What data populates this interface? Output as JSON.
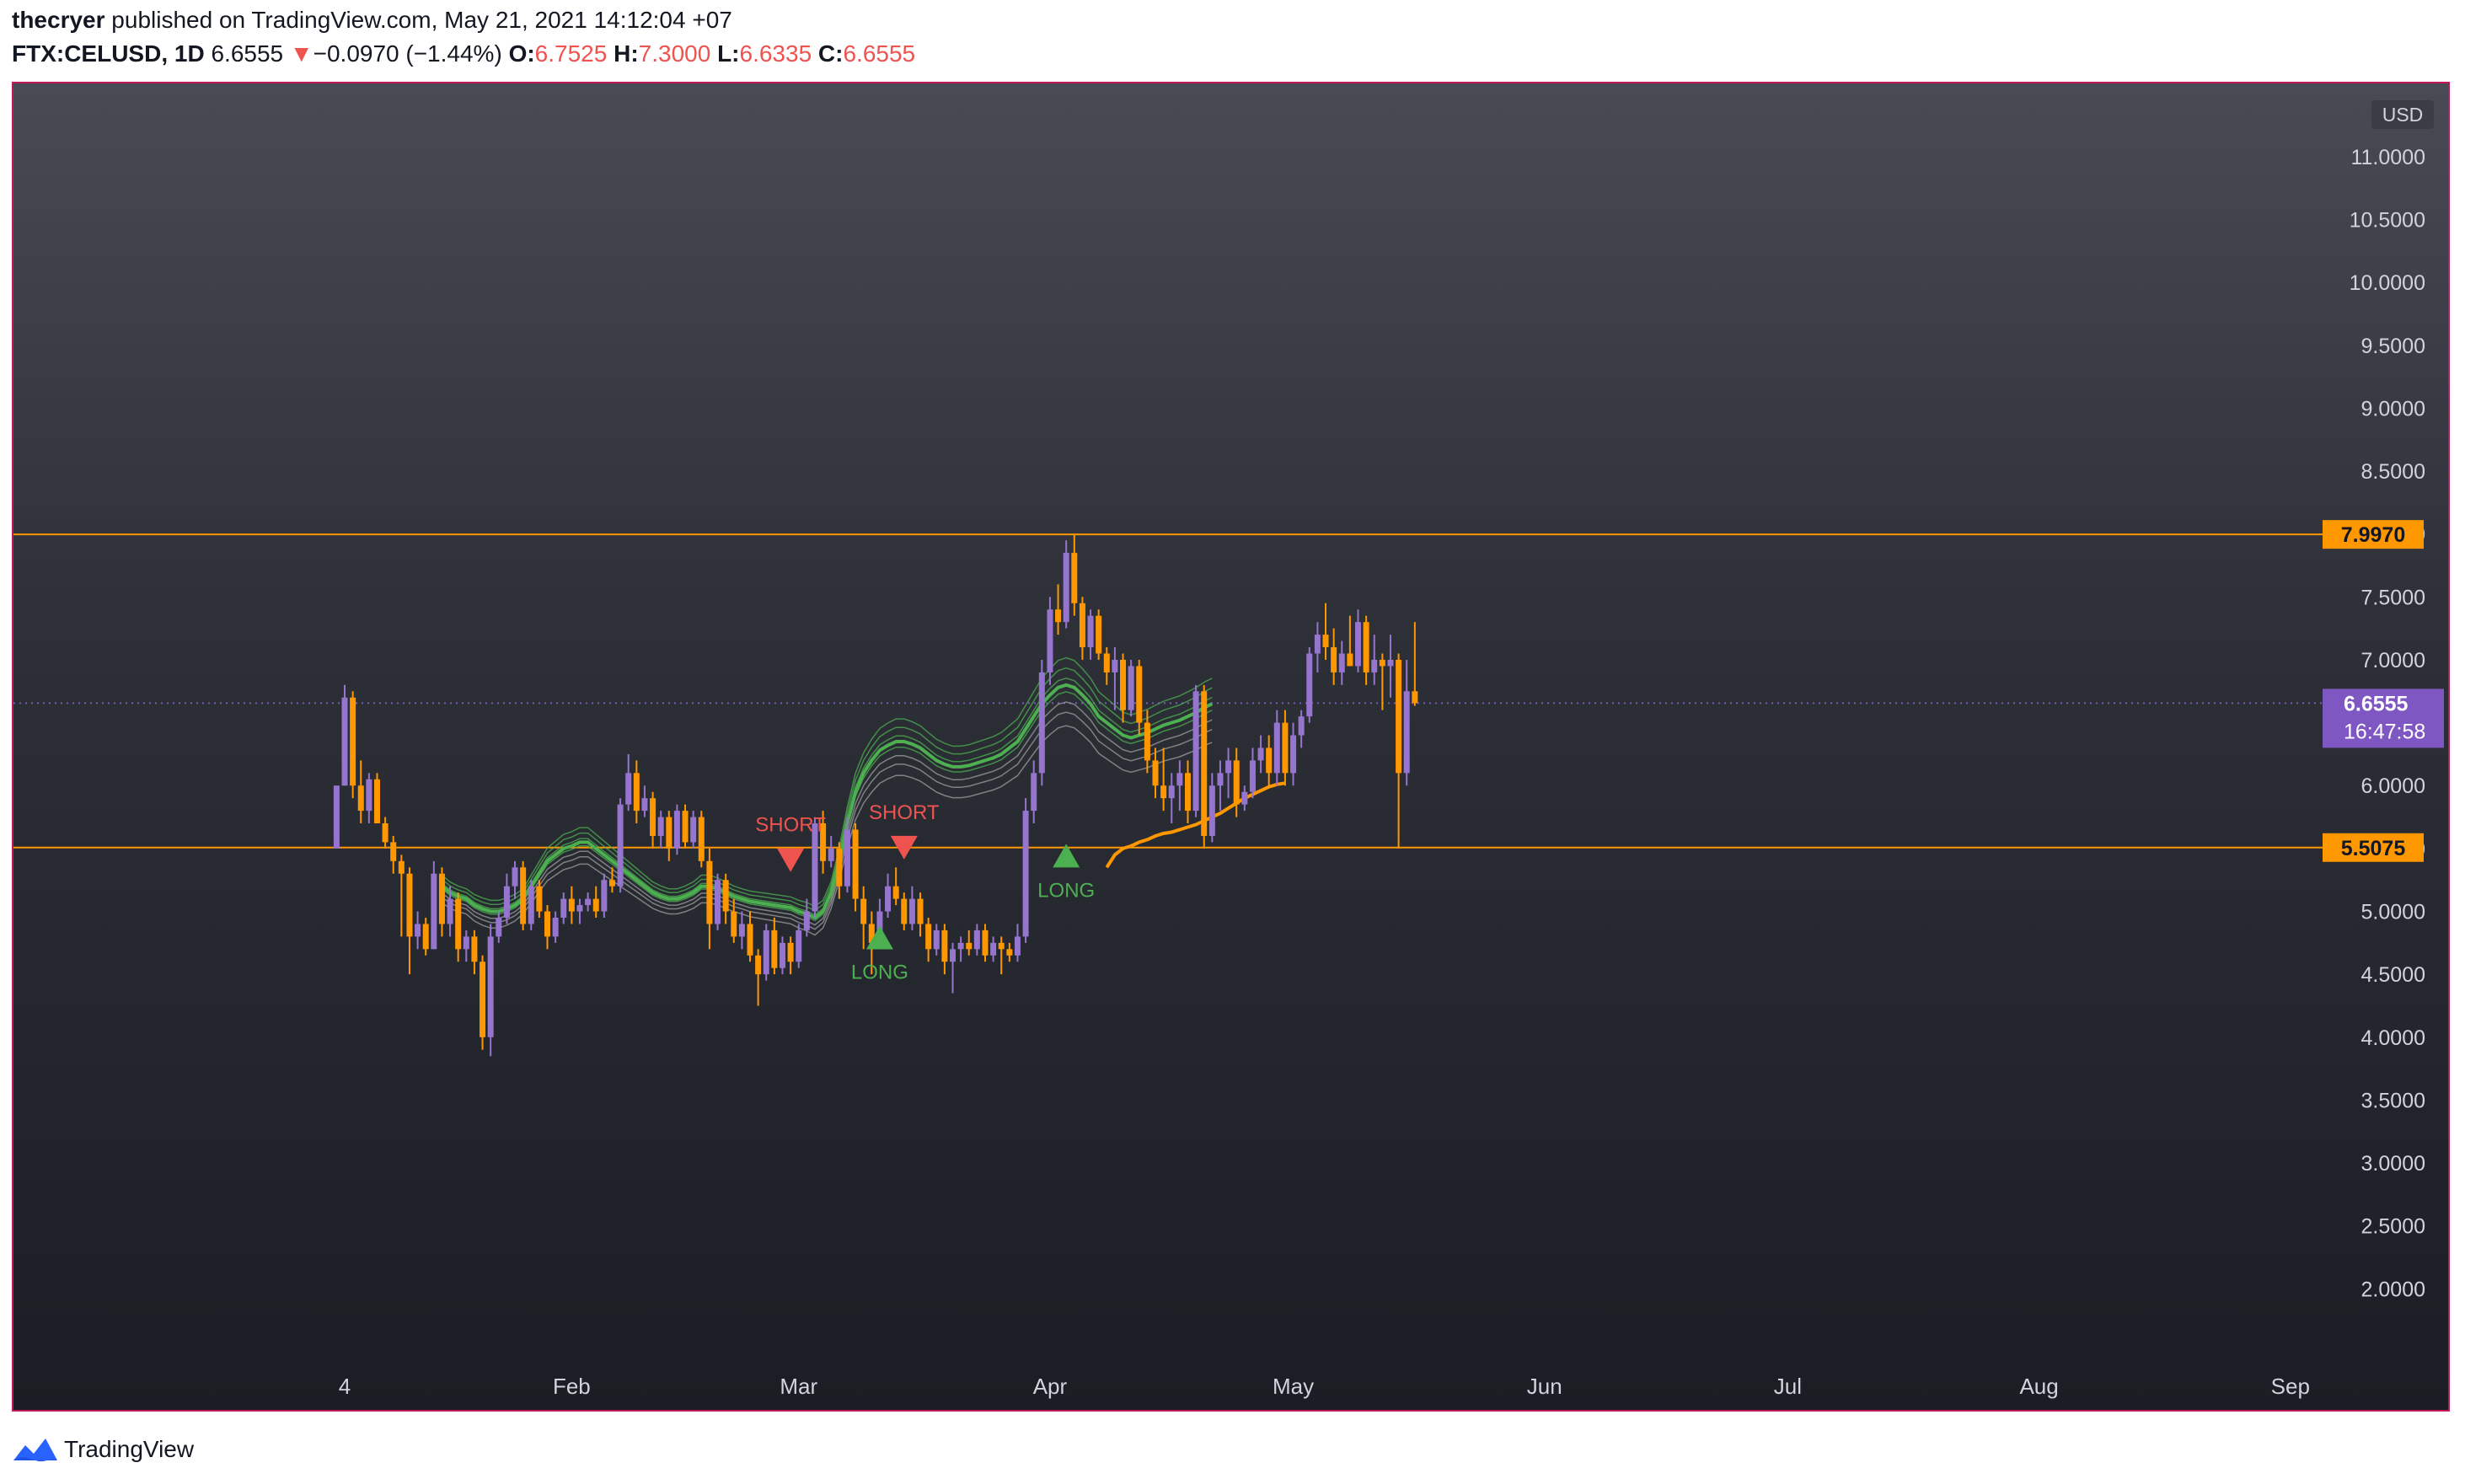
{
  "header": {
    "author": "thecryer",
    "published_text": "published on TradingView.com, May 21, 2021 14:12:04 +07",
    "symbol": "FTX:CELUSD, 1D",
    "last": "6.6555",
    "change_arrow": "▼",
    "change": "−0.0970 (−1.44%)",
    "o_label": "O:",
    "o_value": "6.7525",
    "h_label": "H:",
    "h_value": "7.3000",
    "l_label": "L:",
    "l_value": "6.6335",
    "c_label": "C:",
    "c_value": "6.6555"
  },
  "footer": {
    "brand": "TradingView",
    "logo_icon": "tradingview-logo-icon"
  },
  "colors": {
    "bull": "#9575cd",
    "bear": "#ff9800",
    "level": "#ff9800",
    "price_tag": "#7e57c2",
    "short": "#ef5350",
    "long": "#4caf50",
    "ema": "#ff9800",
    "ribbon_green": "#4caf50",
    "ribbon_grey": "#9e9e9e",
    "ribbon_red": "#ef5350",
    "frame": "#c2185b"
  },
  "chart_data": {
    "type": "candlestick",
    "currency": "USD",
    "y_ticks": [
      "11.0000",
      "10.5000",
      "10.0000",
      "9.5000",
      "9.0000",
      "8.5000",
      "8.0000",
      "7.5000",
      "7.0000",
      "6.5000",
      "6.0000",
      "5.5000",
      "5.0000",
      "4.5000",
      "4.0000",
      "3.5000",
      "3.0000",
      "2.5000",
      "2.0000"
    ],
    "ylim": [
      1.5,
      11.2
    ],
    "x_ticks": [
      {
        "label": "4",
        "date": "2021-01-04"
      },
      {
        "label": "Feb",
        "date": "2021-02-01"
      },
      {
        "label": "Mar",
        "date": "2021-03-01"
      },
      {
        "label": "Apr",
        "date": "2021-04-01"
      },
      {
        "label": "May",
        "date": "2021-05-01"
      },
      {
        "label": "Jun",
        "date": "2021-06-01"
      },
      {
        "label": "Jul",
        "date": "2021-07-01"
      },
      {
        "label": "Aug",
        "date": "2021-08-01"
      },
      {
        "label": "Sep",
        "date": "2021-09-01"
      }
    ],
    "horizontal_levels": [
      {
        "value": 7.997,
        "label": "7.9970"
      },
      {
        "value": 5.5075,
        "label": "5.5075"
      }
    ],
    "current_price": {
      "value": 6.6555,
      "label": "6.6555",
      "countdown": "16:47:58"
    },
    "signals": [
      {
        "type": "SHORT",
        "date": "2021-02-28",
        "price": 5.3
      },
      {
        "type": "SHORT",
        "date": "2021-03-14",
        "price": 5.4
      },
      {
        "type": "LONG",
        "date": "2021-03-11",
        "price": 4.9
      },
      {
        "type": "LONG",
        "date": "2021-04-03",
        "price": 5.55
      }
    ],
    "series": [
      {
        "name": "candles",
        "start": "2021-01-03",
        "ohlc": [
          [
            5.5,
            6.0,
            5.5,
            6.0
          ],
          [
            6.0,
            6.8,
            6.0,
            6.7
          ],
          [
            6.7,
            6.75,
            5.9,
            6.0
          ],
          [
            6.0,
            6.2,
            5.7,
            5.8
          ],
          [
            5.8,
            6.1,
            5.7,
            6.05
          ],
          [
            6.05,
            6.1,
            5.7,
            5.7
          ],
          [
            5.7,
            5.75,
            5.5,
            5.55
          ],
          [
            5.55,
            5.6,
            5.3,
            5.4
          ],
          [
            5.4,
            5.45,
            4.8,
            5.3
          ],
          [
            5.3,
            5.35,
            4.5,
            4.8
          ],
          [
            4.8,
            5.0,
            4.7,
            4.9
          ],
          [
            4.9,
            4.95,
            4.65,
            4.7
          ],
          [
            4.7,
            5.4,
            4.7,
            5.3
          ],
          [
            5.3,
            5.35,
            4.8,
            4.9
          ],
          [
            4.9,
            5.2,
            4.8,
            5.1
          ],
          [
            5.1,
            5.15,
            4.6,
            4.7
          ],
          [
            4.7,
            4.85,
            4.6,
            4.8
          ],
          [
            4.8,
            4.85,
            4.5,
            4.6
          ],
          [
            4.6,
            4.65,
            3.9,
            4.0
          ],
          [
            4.0,
            4.9,
            3.85,
            4.8
          ],
          [
            4.8,
            5.0,
            4.75,
            4.95
          ],
          [
            4.95,
            5.3,
            4.9,
            5.2
          ],
          [
            5.2,
            5.4,
            5.1,
            5.35
          ],
          [
            5.35,
            5.4,
            4.85,
            4.9
          ],
          [
            4.9,
            5.25,
            4.85,
            5.2
          ],
          [
            5.2,
            5.25,
            4.95,
            5.0
          ],
          [
            5.0,
            5.05,
            4.7,
            4.8
          ],
          [
            4.8,
            5.0,
            4.75,
            4.95
          ],
          [
            4.95,
            5.15,
            4.9,
            5.1
          ],
          [
            5.1,
            5.2,
            4.9,
            5.0
          ],
          [
            5.0,
            5.1,
            4.9,
            5.05
          ],
          [
            5.05,
            5.15,
            5.0,
            5.1
          ],
          [
            5.1,
            5.2,
            4.95,
            5.0
          ],
          [
            5.0,
            5.3,
            4.95,
            5.25
          ],
          [
            5.25,
            5.35,
            5.15,
            5.2
          ],
          [
            5.2,
            5.9,
            5.15,
            5.85
          ],
          [
            5.85,
            6.25,
            5.8,
            6.1
          ],
          [
            6.1,
            6.2,
            5.7,
            5.8
          ],
          [
            5.8,
            6.0,
            5.75,
            5.9
          ],
          [
            5.9,
            5.95,
            5.5,
            5.6
          ],
          [
            5.6,
            5.8,
            5.5,
            5.75
          ],
          [
            5.75,
            5.8,
            5.4,
            5.5
          ],
          [
            5.5,
            5.85,
            5.45,
            5.8
          ],
          [
            5.8,
            5.85,
            5.5,
            5.55
          ],
          [
            5.55,
            5.8,
            5.5,
            5.75
          ],
          [
            5.75,
            5.8,
            5.35,
            5.4
          ],
          [
            5.4,
            5.5,
            4.7,
            4.9
          ],
          [
            4.9,
            5.3,
            4.85,
            5.25
          ],
          [
            5.25,
            5.3,
            4.9,
            5.0
          ],
          [
            5.0,
            5.1,
            4.75,
            4.8
          ],
          [
            4.8,
            5.0,
            4.7,
            4.9
          ],
          [
            4.9,
            5.0,
            4.6,
            4.65
          ],
          [
            4.65,
            4.7,
            4.25,
            4.5
          ],
          [
            4.5,
            4.9,
            4.45,
            4.85
          ],
          [
            4.85,
            4.95,
            4.5,
            4.55
          ],
          [
            4.55,
            4.8,
            4.5,
            4.75
          ],
          [
            4.75,
            4.8,
            4.5,
            4.6
          ],
          [
            4.6,
            4.9,
            4.55,
            4.85
          ],
          [
            4.85,
            5.1,
            4.8,
            5.0
          ],
          [
            5.0,
            5.75,
            4.95,
            5.7
          ],
          [
            5.7,
            5.8,
            5.3,
            5.4
          ],
          [
            5.4,
            5.6,
            5.35,
            5.5
          ],
          [
            5.5,
            5.55,
            5.1,
            5.2
          ],
          [
            5.2,
            5.75,
            5.15,
            5.65
          ],
          [
            5.65,
            5.7,
            5.0,
            5.1
          ],
          [
            5.1,
            5.2,
            4.7,
            4.9
          ],
          [
            4.9,
            5.0,
            4.5,
            4.75
          ],
          [
            4.75,
            5.1,
            4.7,
            5.0
          ],
          [
            5.0,
            5.3,
            4.95,
            5.2
          ],
          [
            5.2,
            5.35,
            5.05,
            5.1
          ],
          [
            5.1,
            5.15,
            4.85,
            4.9
          ],
          [
            4.9,
            5.2,
            4.85,
            5.1
          ],
          [
            5.1,
            5.15,
            4.8,
            4.9
          ],
          [
            4.9,
            4.95,
            4.6,
            4.7
          ],
          [
            4.7,
            4.9,
            4.65,
            4.85
          ],
          [
            4.85,
            4.9,
            4.5,
            4.6
          ],
          [
            4.6,
            4.75,
            4.35,
            4.7
          ],
          [
            4.7,
            4.8,
            4.6,
            4.75
          ],
          [
            4.75,
            4.85,
            4.65,
            4.7
          ],
          [
            4.7,
            4.9,
            4.65,
            4.85
          ],
          [
            4.85,
            4.9,
            4.6,
            4.65
          ],
          [
            4.65,
            4.8,
            4.6,
            4.75
          ],
          [
            4.75,
            4.8,
            4.5,
            4.7
          ],
          [
            4.7,
            4.75,
            4.6,
            4.65
          ],
          [
            4.65,
            4.9,
            4.6,
            4.8
          ],
          [
            4.8,
            5.9,
            4.75,
            5.8
          ],
          [
            5.8,
            6.2,
            5.7,
            6.1
          ],
          [
            6.1,
            7.0,
            6.0,
            6.9
          ],
          [
            6.9,
            7.5,
            6.8,
            7.4
          ],
          [
            7.4,
            7.6,
            7.2,
            7.3
          ],
          [
            7.3,
            7.95,
            7.25,
            7.85
          ],
          [
            7.85,
            8.0,
            7.35,
            7.45
          ],
          [
            7.45,
            7.5,
            7.0,
            7.1
          ],
          [
            7.1,
            7.4,
            7.0,
            7.35
          ],
          [
            7.35,
            7.4,
            7.0,
            7.05
          ],
          [
            7.05,
            7.1,
            6.8,
            6.9
          ],
          [
            6.9,
            7.1,
            6.6,
            7.0
          ],
          [
            7.0,
            7.05,
            6.5,
            6.6
          ],
          [
            6.6,
            7.0,
            6.55,
            6.95
          ],
          [
            6.95,
            7.0,
            6.4,
            6.5
          ],
          [
            6.5,
            6.6,
            6.1,
            6.2
          ],
          [
            6.2,
            6.3,
            5.9,
            6.0
          ],
          [
            6.0,
            6.3,
            5.8,
            5.9
          ],
          [
            5.9,
            6.1,
            5.7,
            6.0
          ],
          [
            6.0,
            6.2,
            5.8,
            6.1
          ],
          [
            6.1,
            6.2,
            5.7,
            5.8
          ],
          [
            5.8,
            6.8,
            5.75,
            6.75
          ],
          [
            6.75,
            6.8,
            5.5,
            5.6
          ],
          [
            5.6,
            6.1,
            5.55,
            6.0
          ],
          [
            6.0,
            6.2,
            5.8,
            6.1
          ],
          [
            6.1,
            6.3,
            5.9,
            6.2
          ],
          [
            6.2,
            6.3,
            5.75,
            5.85
          ],
          [
            5.85,
            6.0,
            5.8,
            5.95
          ],
          [
            5.95,
            6.3,
            5.9,
            6.2
          ],
          [
            6.2,
            6.4,
            6.1,
            6.3
          ],
          [
            6.3,
            6.4,
            6.0,
            6.1
          ],
          [
            6.1,
            6.6,
            6.0,
            6.5
          ],
          [
            6.5,
            6.6,
            6.0,
            6.1
          ],
          [
            6.1,
            6.5,
            6.0,
            6.4
          ],
          [
            6.4,
            6.6,
            6.3,
            6.55
          ],
          [
            6.55,
            7.1,
            6.5,
            7.05
          ],
          [
            7.05,
            7.3,
            6.9,
            7.2
          ],
          [
            7.2,
            7.45,
            7.0,
            7.1
          ],
          [
            7.1,
            7.25,
            6.8,
            6.9
          ],
          [
            6.9,
            7.15,
            6.8,
            7.05
          ],
          [
            7.05,
            7.35,
            6.95,
            6.95
          ],
          [
            6.95,
            7.4,
            6.9,
            7.3
          ],
          [
            7.3,
            7.35,
            6.8,
            6.9
          ],
          [
            6.9,
            7.2,
            6.8,
            7.0
          ],
          [
            7.0,
            7.05,
            6.6,
            6.95
          ],
          [
            6.95,
            7.2,
            6.7,
            7.0
          ],
          [
            7.0,
            7.05,
            5.5,
            6.1
          ],
          [
            6.1,
            7.0,
            6.0,
            6.75
          ],
          [
            6.75,
            7.3,
            6.6335,
            6.6555
          ]
        ]
      },
      {
        "name": "EMA",
        "start": "2021-04-08",
        "values": [
          5.35,
          5.45,
          5.5,
          5.52,
          5.55,
          5.57,
          5.6,
          5.62,
          5.63,
          5.65,
          5.67,
          5.69,
          5.72,
          5.75,
          5.78,
          5.82,
          5.86,
          5.9,
          5.93,
          5.96,
          5.99,
          6.01,
          6.02
        ]
      },
      {
        "name": "ribbon",
        "start": "2021-01-16",
        "values": [
          5.2,
          5.15,
          5.12,
          5.1,
          5.05,
          5.02,
          5.0,
          5.0,
          5.02,
          5.05,
          5.1,
          5.2,
          5.3,
          5.4,
          5.45,
          5.5,
          5.52,
          5.55,
          5.55,
          5.5,
          5.45,
          5.4,
          5.35,
          5.3,
          5.25,
          5.2,
          5.15,
          5.12,
          5.1,
          5.1,
          5.12,
          5.15,
          5.2,
          5.2,
          5.18,
          5.15,
          5.12,
          5.1,
          5.08,
          5.07,
          5.06,
          5.05,
          5.04,
          5.03,
          5.0,
          4.98,
          4.95,
          5.0,
          5.15,
          5.4,
          5.7,
          5.95,
          6.1,
          6.2,
          6.28,
          6.32,
          6.35,
          6.35,
          6.33,
          6.3,
          6.25,
          6.2,
          6.17,
          6.15,
          6.15,
          6.16,
          6.18,
          6.2,
          6.22,
          6.25,
          6.3,
          6.35,
          6.45,
          6.55,
          6.65,
          6.72,
          6.78,
          6.8,
          6.78,
          6.72,
          6.65,
          6.55,
          6.5,
          6.45,
          6.4,
          6.38,
          6.4,
          6.42,
          6.45,
          6.48,
          6.5,
          6.52,
          6.55,
          6.58,
          6.62,
          6.65
        ]
      }
    ]
  }
}
